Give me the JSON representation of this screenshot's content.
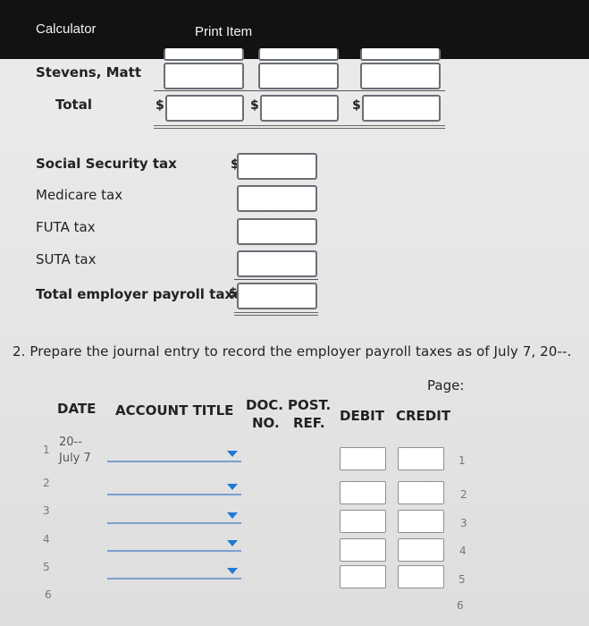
{
  "topbar": {
    "calculator": "Calculator",
    "print_item": "Print Item"
  },
  "employee_rows": {
    "name": "Stevens, Matt",
    "total": "Total",
    "dollar": "$"
  },
  "taxes": {
    "dollar": "$",
    "social_security": "Social Security tax",
    "medicare": "Medicare tax",
    "futa": "FUTA tax",
    "suta": "SUTA tax",
    "total": "Total employer payroll taxes"
  },
  "instruction": "2. Prepare the journal entry to record the employer payroll taxes as of July 7, 20--.",
  "journal": {
    "page_label": "Page:",
    "headers": {
      "date": "DATE",
      "account_title": "ACCOUNT TITLE",
      "doc_top": "DOC.",
      "doc_bottom": "NO.",
      "post_top": "POST.",
      "post_bottom": "REF.",
      "debit": "DEBIT",
      "credit": "CREDIT"
    },
    "year": "20--",
    "date": "July 7",
    "lines": [
      "1",
      "2",
      "3",
      "4",
      "5",
      "6"
    ]
  }
}
